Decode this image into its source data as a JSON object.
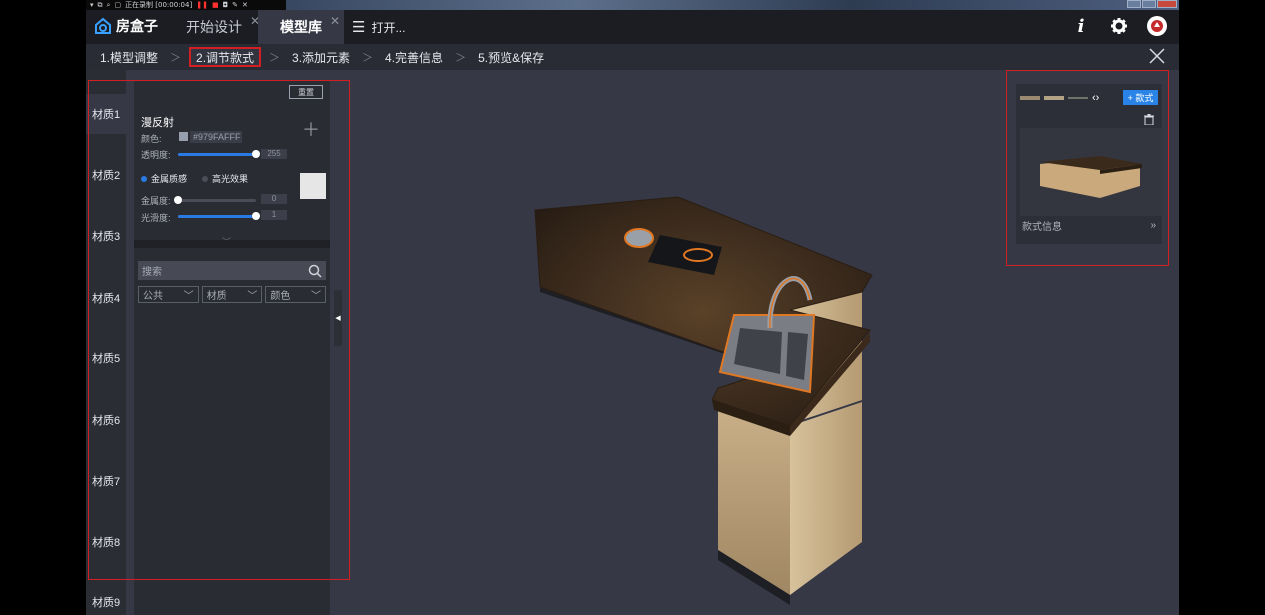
{
  "recorder": {
    "status": "正在录制 [00:00:04]"
  },
  "header": {
    "brand": "房盒子",
    "tabs": [
      {
        "label": "开始设计",
        "active": false
      },
      {
        "label": "模型库",
        "active": true
      }
    ],
    "open_label": "打开..."
  },
  "steps": [
    {
      "label": "1.模型调整",
      "current": false
    },
    {
      "label": "2.调节款式",
      "current": true
    },
    {
      "label": "3.添加元素",
      "current": false
    },
    {
      "label": "4.完善信息",
      "current": false
    },
    {
      "label": "5.预览&保存",
      "current": false
    }
  ],
  "materials": [
    "材质1",
    "材质2",
    "材质3",
    "材质4",
    "材质5",
    "材质6",
    "材质7",
    "材质8",
    "材质9"
  ],
  "editor": {
    "reset_label": "重置",
    "diffuse_title": "漫反射",
    "color_label": "颜色:",
    "color_hex": "#979FAFFF",
    "opacity_label": "透明度:",
    "opacity_value": "255",
    "opacity_fraction": 1.0,
    "metal_option": "金属质感",
    "gloss_option": "高光效果",
    "selected_option": "metal",
    "metalness_label": "金属度:",
    "metalness_value": "0",
    "metalness_fraction": 0.0,
    "smoothness_label": "光滑度:",
    "smoothness_value": "1",
    "smoothness_fraction": 1.0,
    "accent_color": "#2a7ae4"
  },
  "search": {
    "placeholder": "搜索",
    "filters": [
      "公共",
      "材质",
      "颜色"
    ]
  },
  "styles_panel": {
    "add_label": "+ 款式",
    "info_label": "款式信息"
  }
}
